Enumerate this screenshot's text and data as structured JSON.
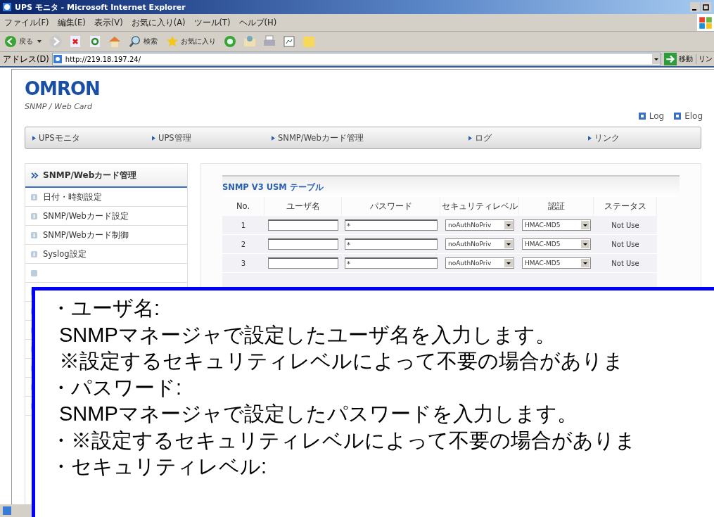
{
  "window": {
    "title": "UPS モニタ - Microsoft Internet Explorer"
  },
  "menu": [
    "ファイル(F)",
    "編集(E)",
    "表示(V)",
    "お気に入り(A)",
    "ツール(T)",
    "ヘルプ(H)"
  ],
  "toolbar": {
    "back": "戻る",
    "search": "検索",
    "favorites": "お気に入り"
  },
  "address": {
    "label": "アドレス(D)",
    "url": "http://219.18.197.24/",
    "go": "移動",
    "links": "リン"
  },
  "page": {
    "logo": "OMRON",
    "subtitle": "SNMP / Web Card",
    "links": [
      "Log",
      "Elog"
    ],
    "nav": [
      "UPSモニタ",
      "UPS管理",
      "SNMP/Webカード管理",
      "ログ",
      "リンク"
    ],
    "sidebar": {
      "title": "SNMP/Webカード管理",
      "items": [
        "日付・時刻設定",
        "SNMP/Webカード設定",
        "SNMP/Webカード制御",
        "Syslog設定"
      ]
    },
    "table": {
      "title": "SNMP V3 USM テーブル",
      "columns": [
        "No.",
        "ユーザ名",
        "パスワード",
        "セキュリティレベル",
        "認証",
        "ステータス"
      ],
      "rows": [
        {
          "no": "1",
          "password": "*",
          "security": "noAuthNoPriv",
          "auth": "HMAC-MD5",
          "status": "Not Use"
        },
        {
          "no": "2",
          "password": "*",
          "security": "noAuthNoPriv",
          "auth": "HMAC-MD5",
          "status": "Not Use"
        },
        {
          "no": "3",
          "password": "*",
          "security": "noAuthNoPriv",
          "auth": "HMAC-MD5",
          "status": "Not Use"
        }
      ]
    }
  },
  "callout": {
    "lines": [
      {
        "kind": "heading",
        "text": "・ユーザ名:"
      },
      {
        "kind": "body",
        "text": "SNMPマネージャで設定したユーザ名を入力します。"
      },
      {
        "kind": "body",
        "text": "※設定するセキュリティレベルによって不要の場合がありま"
      },
      {
        "kind": "heading",
        "text": "・パスワード:"
      },
      {
        "kind": "body",
        "text": "SNMPマネージャで設定したパスワードを入力します。"
      },
      {
        "kind": "heading",
        "text": "・※設定するセキュリティレベルによって不要の場合がありま"
      },
      {
        "kind": "heading",
        "text": "・セキュリティレベル:"
      }
    ]
  }
}
